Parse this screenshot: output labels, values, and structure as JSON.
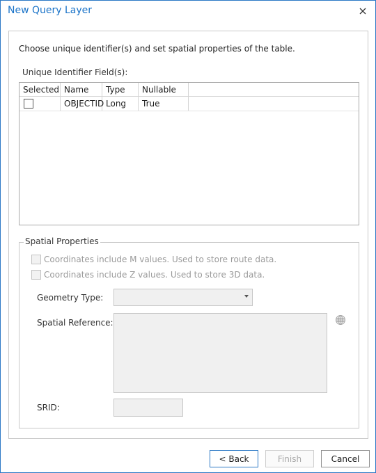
{
  "window": {
    "title": "New Query Layer"
  },
  "intro": "Choose unique identifier(s) and set spatial properties of the table.",
  "uid": {
    "label": "Unique Identifier Field(s):",
    "columns": [
      "Selected",
      "Name",
      "Type",
      "Nullable"
    ],
    "rows": [
      {
        "selected": false,
        "name": "OBJECTID",
        "type": "Long",
        "nullable": "True"
      }
    ]
  },
  "spatial": {
    "legend": "Spatial Properties",
    "m_values": "Coordinates include M values. Used to store route data.",
    "z_values": "Coordinates include Z values. Used to store 3D data.",
    "geometry_type_label": "Geometry Type:",
    "geometry_type_value": "",
    "spatial_reference_label": "Spatial Reference:",
    "srid_label": "SRID:",
    "srid_value": ""
  },
  "buttons": {
    "back": "< Back",
    "finish": "Finish",
    "cancel": "Cancel"
  },
  "icons": {
    "close": "close-icon",
    "globe": "globe-icon",
    "dropdown": "chevron-down-icon"
  },
  "colors": {
    "accent": "#2b78c5",
    "title": "#1a73c8",
    "disabled_text": "#9a9a9a"
  }
}
